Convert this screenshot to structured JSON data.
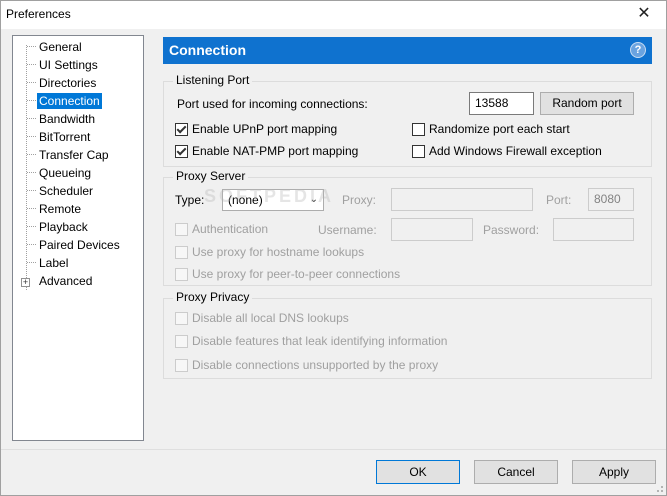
{
  "window": {
    "title": "Preferences",
    "close_glyph": "✕"
  },
  "tree": {
    "items": [
      {
        "label": "General"
      },
      {
        "label": "UI Settings"
      },
      {
        "label": "Directories"
      },
      {
        "label": "Connection",
        "selected": true
      },
      {
        "label": "Bandwidth"
      },
      {
        "label": "BitTorrent"
      },
      {
        "label": "Transfer Cap"
      },
      {
        "label": "Queueing"
      },
      {
        "label": "Scheduler"
      },
      {
        "label": "Remote"
      },
      {
        "label": "Playback"
      },
      {
        "label": "Paired Devices"
      },
      {
        "label": "Label"
      },
      {
        "label": "Advanced",
        "expandable": true
      }
    ],
    "expander_glyph": "+"
  },
  "header": {
    "title": "Connection",
    "help_glyph": "?"
  },
  "listening_port": {
    "title": "Listening Port",
    "port_label": "Port used for incoming connections:",
    "port_value": "13588",
    "random_button": "Random port",
    "upnp": {
      "label": "Enable UPnP port mapping",
      "checked": true
    },
    "natpmp": {
      "label": "Enable NAT-PMP port mapping",
      "checked": true
    },
    "randomize": {
      "label": "Randomize port each start",
      "checked": false
    },
    "firewall": {
      "label": "Add Windows Firewall exception",
      "checked": false
    }
  },
  "proxy_server": {
    "title": "Proxy Server",
    "type_label": "Type:",
    "type_value": "(none)",
    "proxy_label": "Proxy:",
    "port_label": "Port:",
    "port_value": "8080",
    "authentication": "Authentication",
    "username_label": "Username:",
    "password_label": "Password:",
    "hostname_lookups": "Use proxy for hostname lookups",
    "p2p": "Use proxy for peer-to-peer connections"
  },
  "proxy_privacy": {
    "title": "Proxy Privacy",
    "dns": "Disable all local DNS lookups",
    "leak": "Disable features that leak identifying information",
    "unsupported": "Disable connections unsupported by the proxy"
  },
  "footer": {
    "ok": "OK",
    "cancel": "Cancel",
    "apply": "Apply"
  },
  "watermark": "SOFTPEDIA",
  "colors": {
    "accent": "#0f72cf",
    "selection": "#0078d7"
  }
}
